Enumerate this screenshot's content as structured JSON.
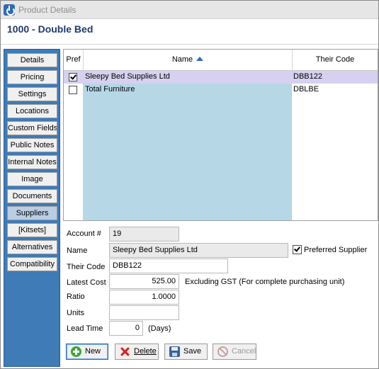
{
  "window": {
    "title": "Product Details",
    "app_icon": "power-icon"
  },
  "header": {
    "title": "1000 - Double Bed"
  },
  "sidebar": {
    "items": [
      {
        "label": "Details"
      },
      {
        "label": "Pricing"
      },
      {
        "label": "Settings"
      },
      {
        "label": "Locations"
      },
      {
        "label": "Custom Fields"
      },
      {
        "label": "Public Notes"
      },
      {
        "label": "Internal Notes"
      },
      {
        "label": "Image"
      },
      {
        "label": "Documents"
      },
      {
        "label": "Suppliers",
        "active": true
      },
      {
        "label": "[Kitsets]"
      },
      {
        "label": "Alternatives"
      },
      {
        "label": "Compatibility"
      }
    ]
  },
  "grid": {
    "columns": {
      "pref": "Pref",
      "name": "Name",
      "code": "Their Code"
    },
    "sort": {
      "column": "Name",
      "direction": "ascending"
    },
    "rows": [
      {
        "pref": true,
        "name": "Sleepy Bed Supplies Ltd",
        "code": "DBB122",
        "selected": true
      },
      {
        "pref": false,
        "name": "Total Furniture",
        "code": "DBLBE",
        "selected": false
      }
    ]
  },
  "form": {
    "account_label": "Account #",
    "account_value": "19",
    "name_label": "Name",
    "name_value": "Sleepy Bed Supplies Ltd",
    "preferred_label": "Preferred Supplier",
    "preferred_checked": true,
    "code_label": "Their Code",
    "code_value": "DBB122",
    "cost_label": "Latest Cost",
    "cost_value": "525.00",
    "cost_hint": "Excluding GST (For complete purchasing unit)",
    "ratio_label": "Ratio",
    "ratio_value": "1.0000",
    "units_label": "Units",
    "units_value": "",
    "lead_label": "Lead Time",
    "lead_value": "0",
    "lead_hint": "(Days)"
  },
  "buttons": {
    "new": "New",
    "delete": "Delete",
    "save": "Save",
    "cancel": "Cancel"
  },
  "colors": {
    "sidebar": "#3f7bb6",
    "name_column": "#b6d8e6",
    "selected_row": "#d7d0f0",
    "header_title": "#1f3a6b"
  }
}
